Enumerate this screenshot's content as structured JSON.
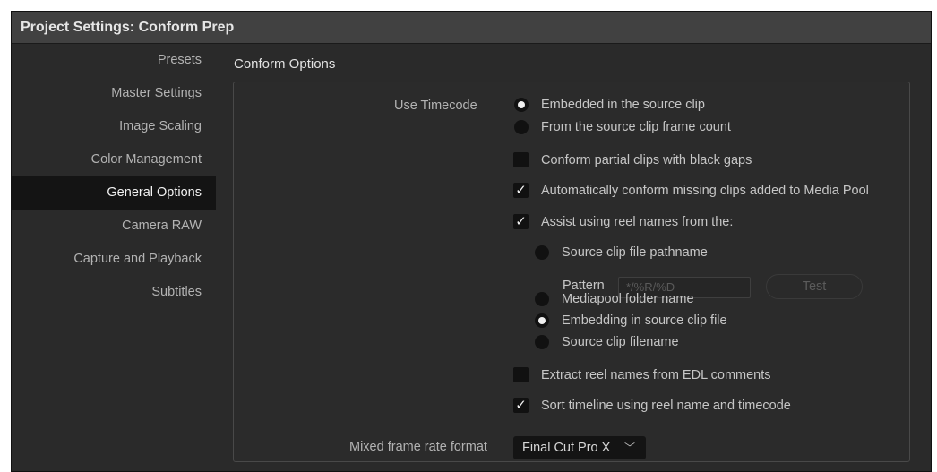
{
  "window": {
    "title": "Project Settings:  Conform Prep"
  },
  "sidebar": {
    "items": [
      {
        "label": "Presets"
      },
      {
        "label": "Master Settings"
      },
      {
        "label": "Image Scaling"
      },
      {
        "label": "Color Management"
      },
      {
        "label": "General Options",
        "active": true
      },
      {
        "label": "Camera RAW"
      },
      {
        "label": "Capture and Playback"
      },
      {
        "label": "Subtitles"
      }
    ]
  },
  "main": {
    "section_title": "Conform Options",
    "use_timecode": {
      "label": "Use Timecode",
      "options": [
        {
          "label": "Embedded in the source clip",
          "checked": true
        },
        {
          "label": "From the source clip frame count",
          "checked": false
        }
      ]
    },
    "conform_partial": {
      "label": "Conform partial clips with black gaps",
      "checked": false
    },
    "auto_conform": {
      "label": "Automatically conform missing clips added to Media Pool",
      "checked": true
    },
    "assist_reel": {
      "label": "Assist using reel names from the:",
      "checked": true
    },
    "reel_sources": [
      {
        "label": "Source clip file pathname",
        "checked": false
      },
      {
        "label": "Mediapool folder name",
        "checked": false
      },
      {
        "label": "Embedding in source clip file",
        "checked": true
      },
      {
        "label": "Source clip filename",
        "checked": false
      }
    ],
    "pattern": {
      "label": "Pattern",
      "value": "*/%R/%D",
      "test_label": "Test"
    },
    "extract_reel": {
      "label": "Extract reel names from EDL comments",
      "checked": false
    },
    "sort_timeline": {
      "label": "Sort timeline using reel name and timecode",
      "checked": true
    },
    "mixed_frame_rate": {
      "label": "Mixed frame rate format",
      "value": "Final Cut Pro X"
    }
  },
  "icons": {
    "checkmark": "checkmark-icon",
    "dropdown": "chevron-down-icon"
  }
}
